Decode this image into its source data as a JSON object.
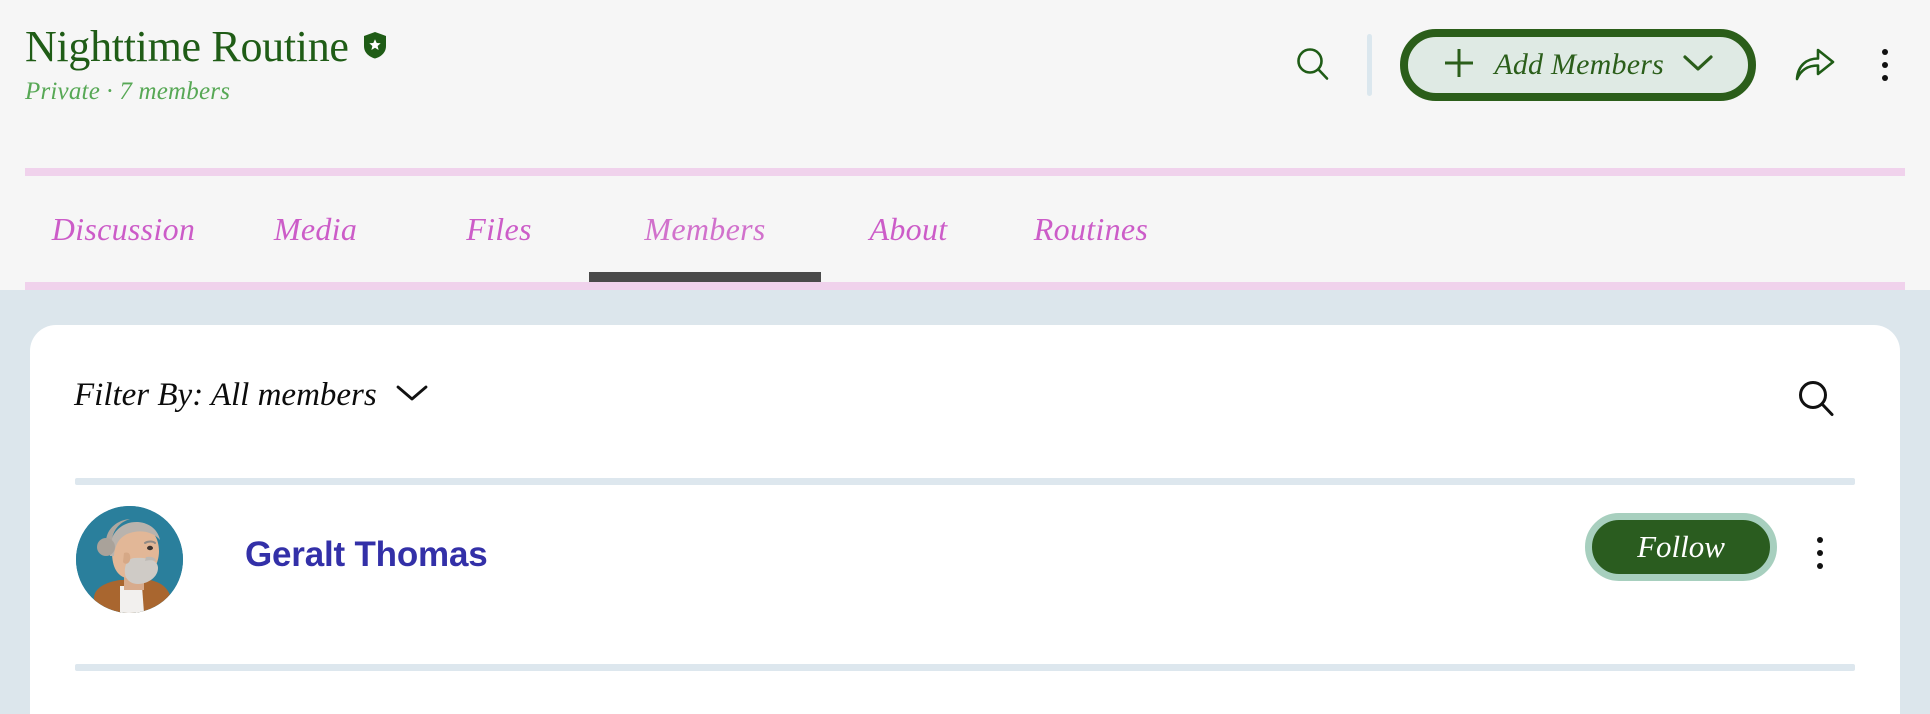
{
  "colors": {
    "header_bg": "#f6f6f6",
    "page_bg": "#dce6ec",
    "card_bg": "#ffffff",
    "brand_green": "#1f5c16",
    "button_green": "#2b5e1a",
    "button_fill": "#dfeae4",
    "meta_green": "#57a855",
    "tab_pink": "#cc5cc8",
    "pink_rule": "#f0d2ec",
    "active_tab_underline": "#4a4a4a",
    "divider": "#dde7ee",
    "member_name": "#3330a8",
    "follow_bg": "#2a5c1f",
    "follow_ring": "#a7cfbe",
    "avatar_bg": "#2a7f9c"
  },
  "header": {
    "title": "Nighttime Routine",
    "verified_icon": "shield-star-icon",
    "meta": "Private · 7 members",
    "search_icon": "search-icon",
    "add_members": {
      "plus_icon": "plus-icon",
      "label": "Add Members",
      "chevron_icon": "chevron-down-icon"
    },
    "share_icon": "share-arrow-icon",
    "more_icon": "kebab-menu-icon"
  },
  "tabs": [
    {
      "label": "Discussion",
      "active": false
    },
    {
      "label": "Media",
      "active": false
    },
    {
      "label": "Files",
      "active": false
    },
    {
      "label": "Members",
      "active": true
    },
    {
      "label": "About",
      "active": false
    },
    {
      "label": "Routines",
      "active": false
    }
  ],
  "card": {
    "filter": {
      "label": "Filter By: All members",
      "chevron_icon": "chevron-down-icon"
    },
    "search_icon": "search-icon",
    "members": [
      {
        "avatar_icon": "user-avatar-photo",
        "name": "Geralt Thomas",
        "follow_label": "Follow",
        "more_icon": "kebab-menu-icon"
      }
    ]
  }
}
